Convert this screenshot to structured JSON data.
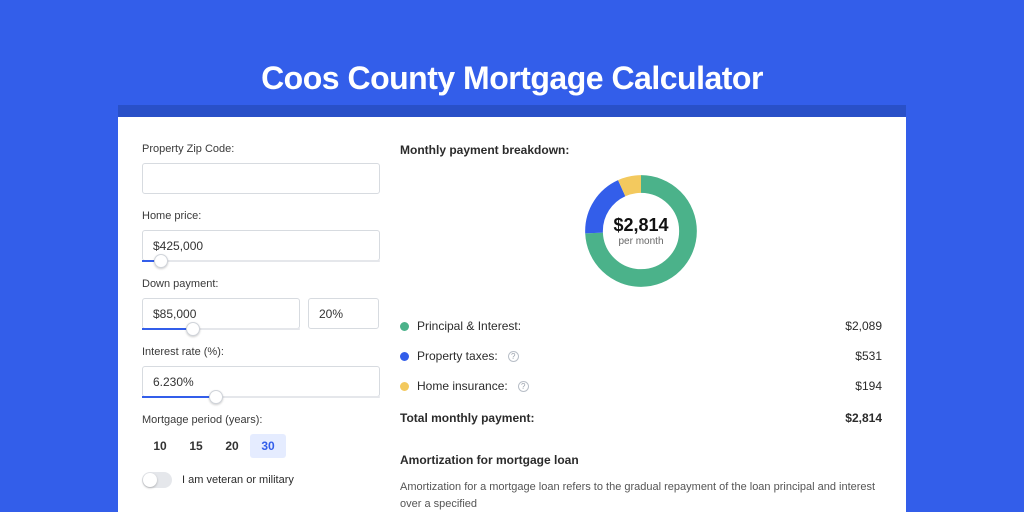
{
  "title": "Coos County Mortgage Calculator",
  "left": {
    "zip_label": "Property Zip Code:",
    "zip_value": "",
    "home_price_label": "Home price:",
    "home_price_value": "$425,000",
    "home_price_slider_pct": 8,
    "down_payment_label": "Down payment:",
    "down_payment_value": "$85,000",
    "down_payment_pct_value": "20%",
    "down_payment_slider_pct": 20,
    "interest_label": "Interest rate (%):",
    "interest_value": "6.230%",
    "interest_slider_pct": 31,
    "period_label": "Mortgage period (years):",
    "periods": [
      "10",
      "15",
      "20",
      "30"
    ],
    "period_selected_index": 3,
    "veteran_label": "I am veteran or military"
  },
  "right": {
    "breakdown_title": "Monthly payment breakdown:",
    "donut_amount": "$2,814",
    "donut_per": "per month",
    "legend": [
      {
        "label": "Principal & Interest:",
        "color": "green",
        "value": "$2,089",
        "info": false
      },
      {
        "label": "Property taxes:",
        "color": "blue",
        "value": "$531",
        "info": true
      },
      {
        "label": "Home insurance:",
        "color": "yellow",
        "value": "$194",
        "info": true
      }
    ],
    "total_label": "Total monthly payment:",
    "total_value": "$2,814",
    "amort_title": "Amortization for mortgage loan",
    "amort_text": "Amortization for a mortgage loan refers to the gradual repayment of the loan principal and interest over a specified"
  },
  "chart_data": {
    "type": "pie",
    "title": "Monthly payment breakdown",
    "series": [
      {
        "name": "Principal & Interest",
        "value": 2089,
        "color": "#4bb28a"
      },
      {
        "name": "Property taxes",
        "value": 531,
        "color": "#335eea"
      },
      {
        "name": "Home insurance",
        "value": 194,
        "color": "#f3c95e"
      }
    ],
    "total": 2814,
    "center_label": "$2,814 per month"
  }
}
